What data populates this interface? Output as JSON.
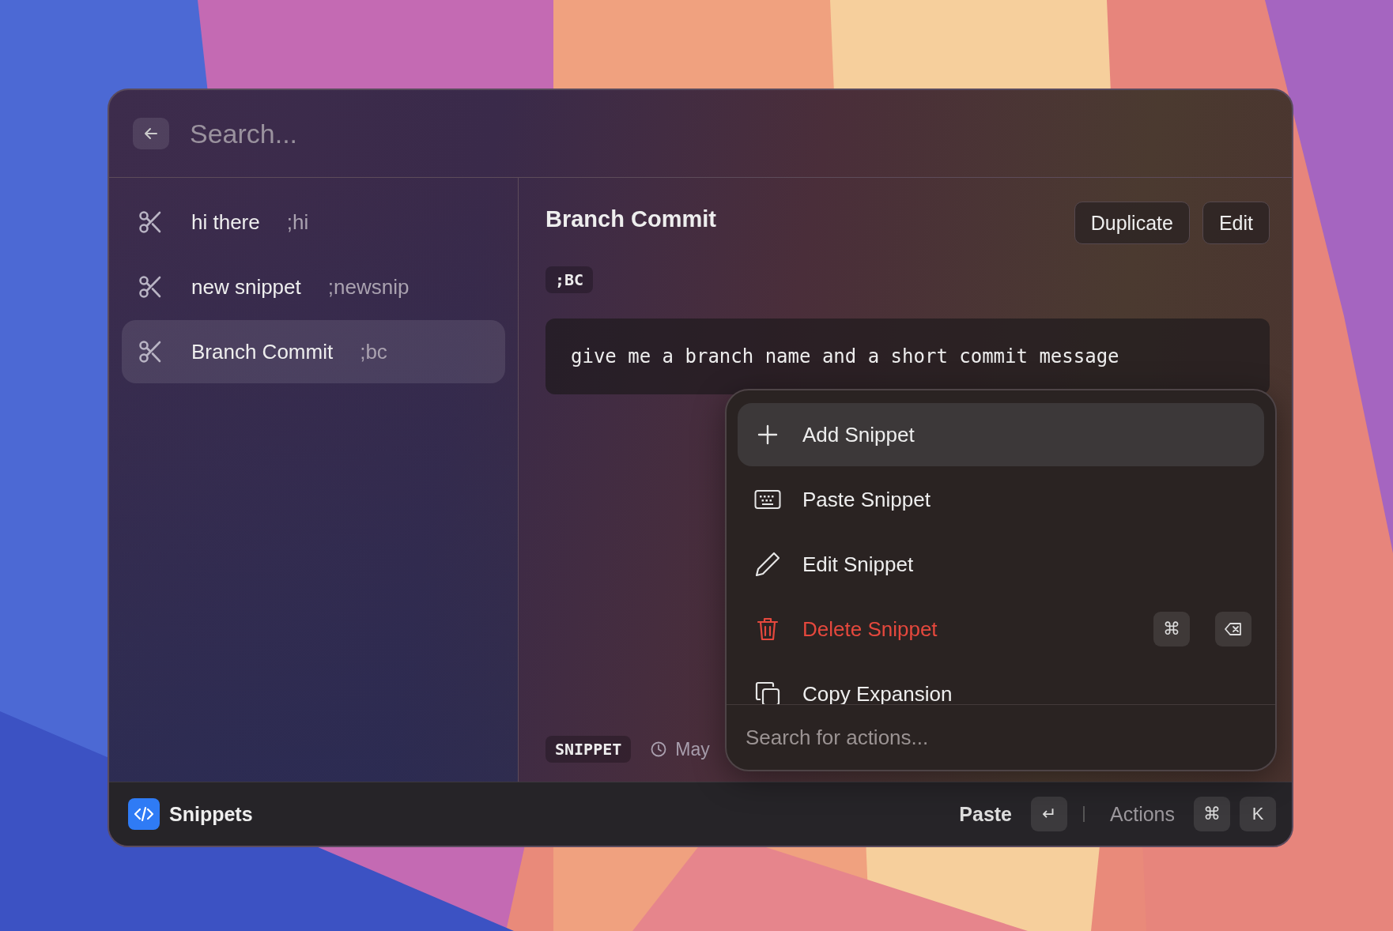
{
  "header": {
    "placeholder": "Search..."
  },
  "snippets": [
    {
      "name": "hi there",
      "keyword": ";hi",
      "selected": false
    },
    {
      "name": "new snippet",
      "keyword": ";newsnip",
      "selected": false
    },
    {
      "name": "Branch Commit",
      "keyword": ";bc",
      "selected": true
    }
  ],
  "detail": {
    "title": "Branch Commit",
    "buttons": [
      "Duplicate",
      "Edit"
    ],
    "keyword": ";BC",
    "content": "give me a branch name and a short commit message",
    "type_tag": "SNIPPET",
    "date": "May"
  },
  "actions": {
    "items": [
      {
        "kind": "add",
        "label": "Add Snippet",
        "selected": true,
        "danger": false
      },
      {
        "kind": "paste",
        "label": "Paste Snippet",
        "selected": false,
        "danger": false
      },
      {
        "kind": "edit",
        "label": "Edit Snippet",
        "selected": false,
        "danger": false
      },
      {
        "kind": "delete",
        "label": "Delete Snippet",
        "selected": false,
        "danger": true,
        "shortcut": [
          {
            "kind": "text",
            "label": "⌘"
          },
          {
            "kind": "backspace"
          }
        ]
      },
      {
        "kind": "copy",
        "label": "Copy Expansion",
        "selected": false,
        "danger": false
      }
    ],
    "placeholder": "Search for actions..."
  },
  "footer": {
    "title": "Snippets",
    "primary": "Paste",
    "primary_key": "↵",
    "secondary": "Actions",
    "secondary_keys": [
      "⌘",
      "K"
    ]
  }
}
